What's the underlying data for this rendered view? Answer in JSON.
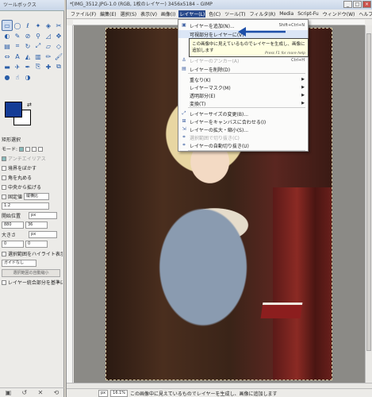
{
  "toolbox": {
    "title": "ツールボックス",
    "tools": [
      "rect-select-icon",
      "ellipse-select-icon",
      "lasso-icon",
      "fuzzy-select-icon",
      "color-select-icon",
      "scissors-icon",
      "foreground-select-icon",
      "paths-icon",
      "color-picker-icon",
      "zoom-icon",
      "measure-icon",
      "move-icon",
      "align-icon",
      "crop-icon",
      "rotate-icon",
      "scale-icon",
      "shear-icon",
      "perspective-icon",
      "flip-icon",
      "text-icon",
      "bucket-fill-icon",
      "blend-icon",
      "pencil-icon",
      "paintbrush-icon",
      "eraser-icon",
      "airbrush-icon",
      "ink-icon",
      "clone-icon",
      "heal-icon",
      "perspective-clone-icon",
      "blur-icon",
      "smudge-icon",
      "dodge-icon"
    ],
    "fg_color": "#143c96",
    "bg_color": "#ffffff",
    "options": {
      "header": "矩形選択",
      "mode_label": "モード:",
      "antialias": "アンチエイリアス",
      "feather": "境界をぼかす",
      "rounded": "角を丸める",
      "expand": "中央から拡げる",
      "fixed_label": "固定値",
      "fixed_select": "縦横比",
      "ratio_value": "1:2",
      "position_label": "開始位置",
      "position_unit": "px",
      "pos_x": "880",
      "pos_y": "36",
      "size_label": "大きさ",
      "size_unit": "px",
      "size_w": "0",
      "size_h": "0",
      "highlight": "選択範囲をハイライト表示",
      "guides": "ガイドなし",
      "auto_shrink": "選択範囲の自動縮小",
      "merged": "レイヤー統合部分を基準に"
    }
  },
  "image_window": {
    "title": "*[IMG_3512.JPG-1.0 (RGB, 1枚のレイヤー) 3456x5184 – GIMP",
    "menus": [
      "ファイル(F)",
      "編集(E)",
      "選択(S)",
      "表示(V)",
      "画像(I)",
      "レイヤー(L)",
      "色(C)",
      "ツール(T)",
      "フィルタ(R)",
      "Media",
      "Script-Fu",
      "ウィンドウ(W)",
      "ヘルプ(H)"
    ],
    "open_menu_index": 5,
    "status": {
      "unit": "px",
      "zoom": "16.1%",
      "message": "この画像中に見えているものでレイヤーを生成し、画像に追加します"
    }
  },
  "layer_menu": {
    "items": [
      {
        "label": "レイヤーを追加(N)...",
        "shortcut": "Shift+Ctrl+N",
        "icon": "new-layer-icon"
      },
      {
        "label": "可視部分をレイヤーに(V)",
        "shortcut": "",
        "icon": "",
        "highlight": true
      },
      {
        "label": "この画像中に見えているものでレイヤーを生成し、画像に追加します",
        "shortcut": "",
        "icon": "",
        "tooltip": true
      },
      {
        "label": "レイヤーのアンカー(A)",
        "shortcut": "Ctrl+H",
        "icon": "anchor-icon",
        "disabled": true
      },
      {
        "label": "レイヤーを削除(D)",
        "shortcut": "",
        "icon": "delete-layer-icon"
      },
      {
        "label": "重なり(K)",
        "submenu": true
      },
      {
        "label": "レイヤーマスク(M)",
        "submenu": true
      },
      {
        "label": "透明部分(E)",
        "submenu": true
      },
      {
        "label": "変換(T)",
        "submenu": true
      },
      {
        "label": "レイヤーサイズの変更(B)...",
        "icon": "layer-size-icon"
      },
      {
        "label": "レイヤーをキャンバスに合わせる(I)",
        "icon": "layer-to-canvas-icon"
      },
      {
        "label": "レイヤーの拡大・縮小(S)...",
        "icon": "scale-layer-icon"
      },
      {
        "label": "選択範囲で切り抜き(C)",
        "icon": "crop-selection-icon",
        "disabled": true
      },
      {
        "label": "レイヤーの自動切り抜き(U)",
        "icon": "autocrop-icon"
      }
    ],
    "tooltip_text": "この画像中に見えているものでレイヤーを生成し、画像に追加します",
    "tooltip_help": "Press F1 for more help",
    "accent_color": "#2b4b8c",
    "arrow_color": "#1d4fa8"
  }
}
